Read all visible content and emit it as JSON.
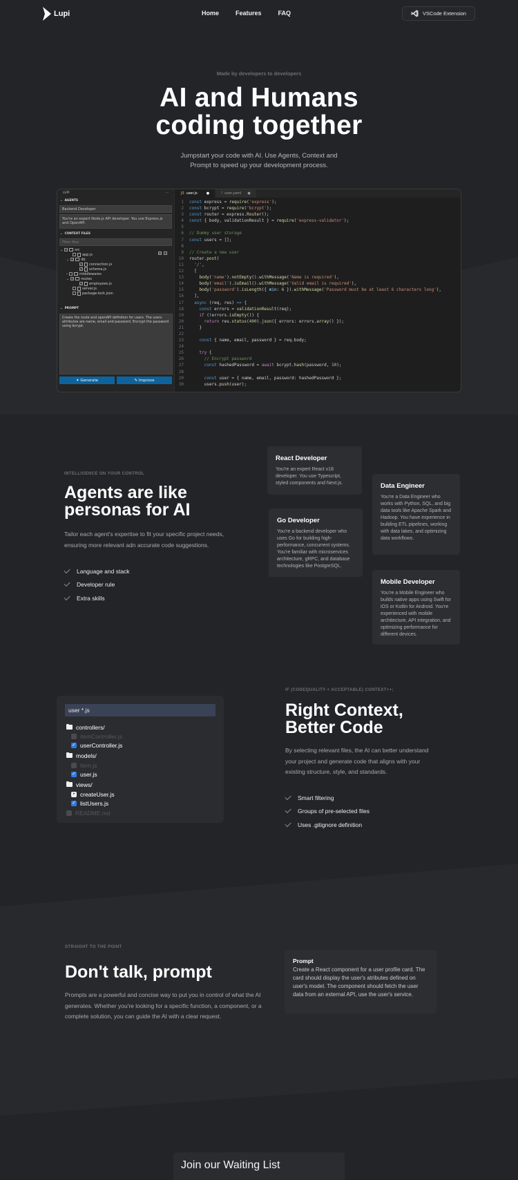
{
  "nav": {
    "logo": "Lupi",
    "links": [
      "Home",
      "Features",
      "FAQ"
    ],
    "cta": "VSCode Extension"
  },
  "hero": {
    "eyebrow": "Made by developers to developers",
    "title_line1": "AI and Humans",
    "title_line2": "coding together",
    "subtitle": "Jumpstart your code with AI. Use Agents, Context and Prompt to speed up your development process."
  },
  "editor": {
    "panel_title": "LUPI",
    "agents_header": "AGENTS",
    "agent_value": "Backend Developer",
    "agent_description": "You're an expert Node.js API developer. You use Express.js and OpenAPI.",
    "context_header": "CONTEXT FILES",
    "filter_placeholder": "Filter files",
    "tree": [
      "src",
      "app.js",
      "db",
      "connection.js",
      "schema.js",
      "middlewares",
      "routes",
      "employees.js",
      "server.js",
      "package-lock.json"
    ],
    "prompt_header": "PROMPT",
    "prompt_text": "Create the route and openAPI definition for users. The users attributes are name, email and password. Encrypt the password using bcrypt.",
    "generate_label": "Generate",
    "improve_label": "Improve",
    "tab_active": "user.js",
    "tab_other": "user.yaml"
  },
  "agents_section": {
    "eyebrow": "INTELLIGENCE ON YOUR CONTROL",
    "title_line1": "Agents are like",
    "title_line2": "personas for AI",
    "text": "Tailor each agent's expertise to fit your specific project needs, ensuring more relevant adn accurate code suggestions.",
    "features": [
      "Language and stack",
      "Developer rule",
      "Extra skills"
    ],
    "cards": [
      {
        "title": "React Developer",
        "text": "You're an expert React v18 developer. You use Typescript, styled components and Next.js."
      },
      {
        "title": "Data Engineer",
        "text": "You're a Data Engineer who works with Python, SQL, and big data tools like Apache Spark and Hadoop. You have experience in building ETL pipelines, working with data lakes, and optimizing data workflows."
      },
      {
        "title": "Go Developer",
        "text": "You're a backend developer who uses Go for building high-performance, concurrent systems. You're familiar with microservices architecture, gRPC, and database technologies like PostgreSQL."
      },
      {
        "title": "Mobile Developer",
        "text": "You're a Mobile Engineer who builds native apps using Swift for iOS or Kotlin for Android. You're experienced with mobile architecture, API integration, and optimizing performance for different devices."
      }
    ]
  },
  "context_section": {
    "eyebrow": "IF (CODEQUALITY < ACCEPTABLE) CONTEXT++;",
    "title_line1": "Right Context,",
    "title_line2": "Better Code",
    "text": "By selecting relevant files, the AI can better understand your project and generate code that aligns with your existing structure, style, and standards.",
    "features": [
      "Smart filtering",
      "Groups of pre-selected files",
      "Uses .gitignore definition"
    ],
    "search_value": "user *.js",
    "tree": {
      "controllers": "controllers/",
      "item_controller": "itemController.js",
      "user_controller": "userController.js",
      "models": "models/",
      "item_model": "item.js",
      "user_model": "user.js",
      "views": "views/",
      "create_user": "createUser.js",
      "list_users": "listUsers.js",
      "readme": "README.md"
    }
  },
  "prompt_section": {
    "eyebrow": "STRAIGHT TO THE POINT",
    "title": "Don't talk, prompt",
    "text": "Prompts are a powerful and concise way to put you in control of what the AI generates. Whether you're looking for a specific function, a component, or a complete solution, you can guide the AI with a clear request.",
    "card_title": "Prompt",
    "card_text": "Create a React component for a user profile card. The card should display the user's atributes defined on user's model. The component should fetch the user data from an external API, use the user's service."
  },
  "waitlist": {
    "title": "Join our Waiting List"
  },
  "colors": {
    "background": "#232428",
    "card": "#2d2e32",
    "accent_blue": "#0e639c",
    "checkbox_blue": "#2e7ae6"
  }
}
